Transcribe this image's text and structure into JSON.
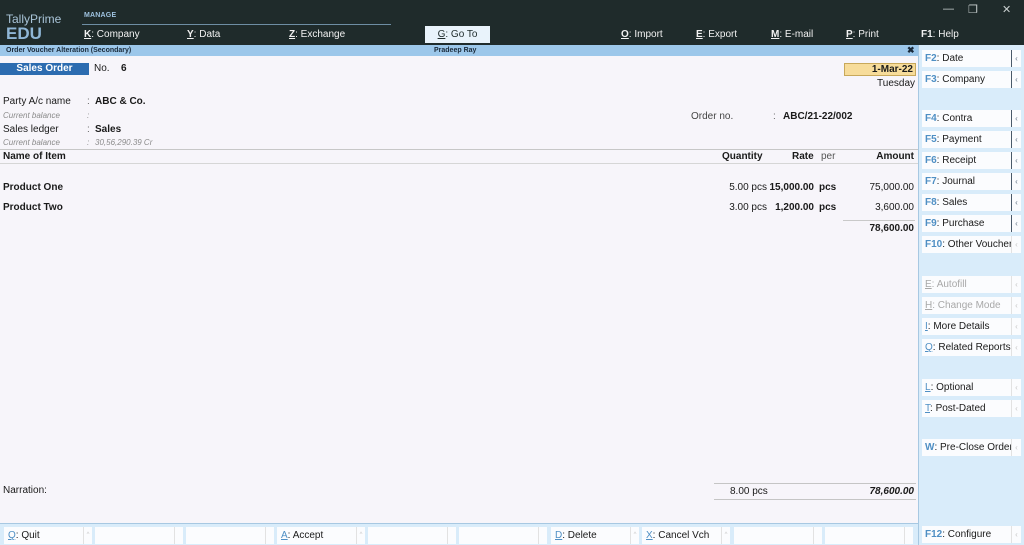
{
  "app": {
    "brand_name": "TallyPrime",
    "brand_edition": "EDU",
    "section_label": "MANAGE",
    "window_controls": {
      "minimize": "—",
      "restore": "❐",
      "close": "✕"
    }
  },
  "top_menu": [
    {
      "key": "K",
      "label": "Company"
    },
    {
      "key": "Y",
      "label": "Data"
    },
    {
      "key": "Z",
      "label": "Exchange"
    },
    {
      "key": "G",
      "label": "Go To"
    },
    {
      "key": "O",
      "label": "Import"
    },
    {
      "key": "E",
      "label": "Export"
    },
    {
      "key": "M",
      "label": "E-mail"
    },
    {
      "key": "P",
      "label": "Print"
    },
    {
      "key": "F1",
      "label": "Help"
    }
  ],
  "title_strip": {
    "screen_title": "Order Voucher Alteration (Secondary)",
    "company": "Pradeep Ray",
    "close": "✖"
  },
  "voucher": {
    "type": "Sales Order",
    "no_label": "No.",
    "no_value": "6",
    "date": "1-Mar-22",
    "day": "Tuesday",
    "party_label": "Party A/c name",
    "party_value": "ABC & Co.",
    "party_balance_label": "Current balance",
    "party_balance_value": "",
    "ledger_label": "Sales ledger",
    "ledger_value": "Sales",
    "ledger_balance_label": "Current balance",
    "ledger_balance_value": "30,56,290.39 Cr",
    "order_no_label": "Order no.",
    "order_no_value": "ABC/21-22/002",
    "colon": ":"
  },
  "table": {
    "headers": {
      "item": "Name of Item",
      "quantity": "Quantity",
      "rate": "Rate",
      "per": "per",
      "amount": "Amount"
    },
    "rows": [
      {
        "item": "Product One",
        "quantity": "5.00 pcs",
        "rate": "15,000.00",
        "per": "pcs",
        "amount": "75,000.00"
      },
      {
        "item": "Product Two",
        "quantity": "3.00 pcs",
        "rate": "1,200.00",
        "per": "pcs",
        "amount": "3,600.00"
      }
    ],
    "subtotal": "78,600.00"
  },
  "footer": {
    "narration_label": "Narration:",
    "total_quantity": "8.00 pcs",
    "total_amount": "78,600.00"
  },
  "right_panel": [
    {
      "key": "F2",
      "label": "Date",
      "state": "enabled"
    },
    {
      "key": "F3",
      "label": "Company",
      "state": "enabled"
    },
    {
      "key": "F4",
      "label": "Contra",
      "state": "enabled"
    },
    {
      "key": "F5",
      "label": "Payment",
      "state": "enabled"
    },
    {
      "key": "F6",
      "label": "Receipt",
      "state": "enabled"
    },
    {
      "key": "F7",
      "label": "Journal",
      "state": "enabled"
    },
    {
      "key": "F8",
      "label": "Sales",
      "state": "enabled"
    },
    {
      "key": "F9",
      "label": "Purchase",
      "state": "enabled"
    },
    {
      "key": "F10",
      "label": "Other Vouchers",
      "state": "enabled"
    },
    {
      "key": "E",
      "label": "Autofill",
      "state": "disabled"
    },
    {
      "key": "H",
      "label": "Change Mode",
      "state": "disabled"
    },
    {
      "key": "I",
      "label": "More Details",
      "state": "enabled"
    },
    {
      "key": "Q",
      "label": "Related Reports",
      "state": "enabled"
    },
    {
      "key": "L",
      "label": "Optional",
      "state": "enabled"
    },
    {
      "key": "T",
      "label": "Post-Dated",
      "state": "enabled"
    },
    {
      "key": "W",
      "label": "Pre-Close Order",
      "state": "enabled"
    }
  ],
  "bottom_bar": [
    {
      "key": "Q",
      "label": "Quit"
    },
    {
      "key": "",
      "label": ""
    },
    {
      "key": "",
      "label": ""
    },
    {
      "key": "A",
      "label": "Accept"
    },
    {
      "key": "",
      "label": ""
    },
    {
      "key": "",
      "label": ""
    },
    {
      "key": "D",
      "label": "Delete"
    },
    {
      "key": "X",
      "label": "Cancel Vch"
    },
    {
      "key": "",
      "label": ""
    },
    {
      "key": "",
      "label": ""
    }
  ],
  "configure": {
    "key": "F12",
    "label": "Configure"
  },
  "colors": {
    "topbar": "#1f2b2b",
    "title_strip": "#9cc7ea",
    "voucher_type_bg": "#2c6cb0",
    "date_bg": "#f7dc9a",
    "panel_bg": "#d9ecfa",
    "key_accent": "#4f8fc4"
  }
}
